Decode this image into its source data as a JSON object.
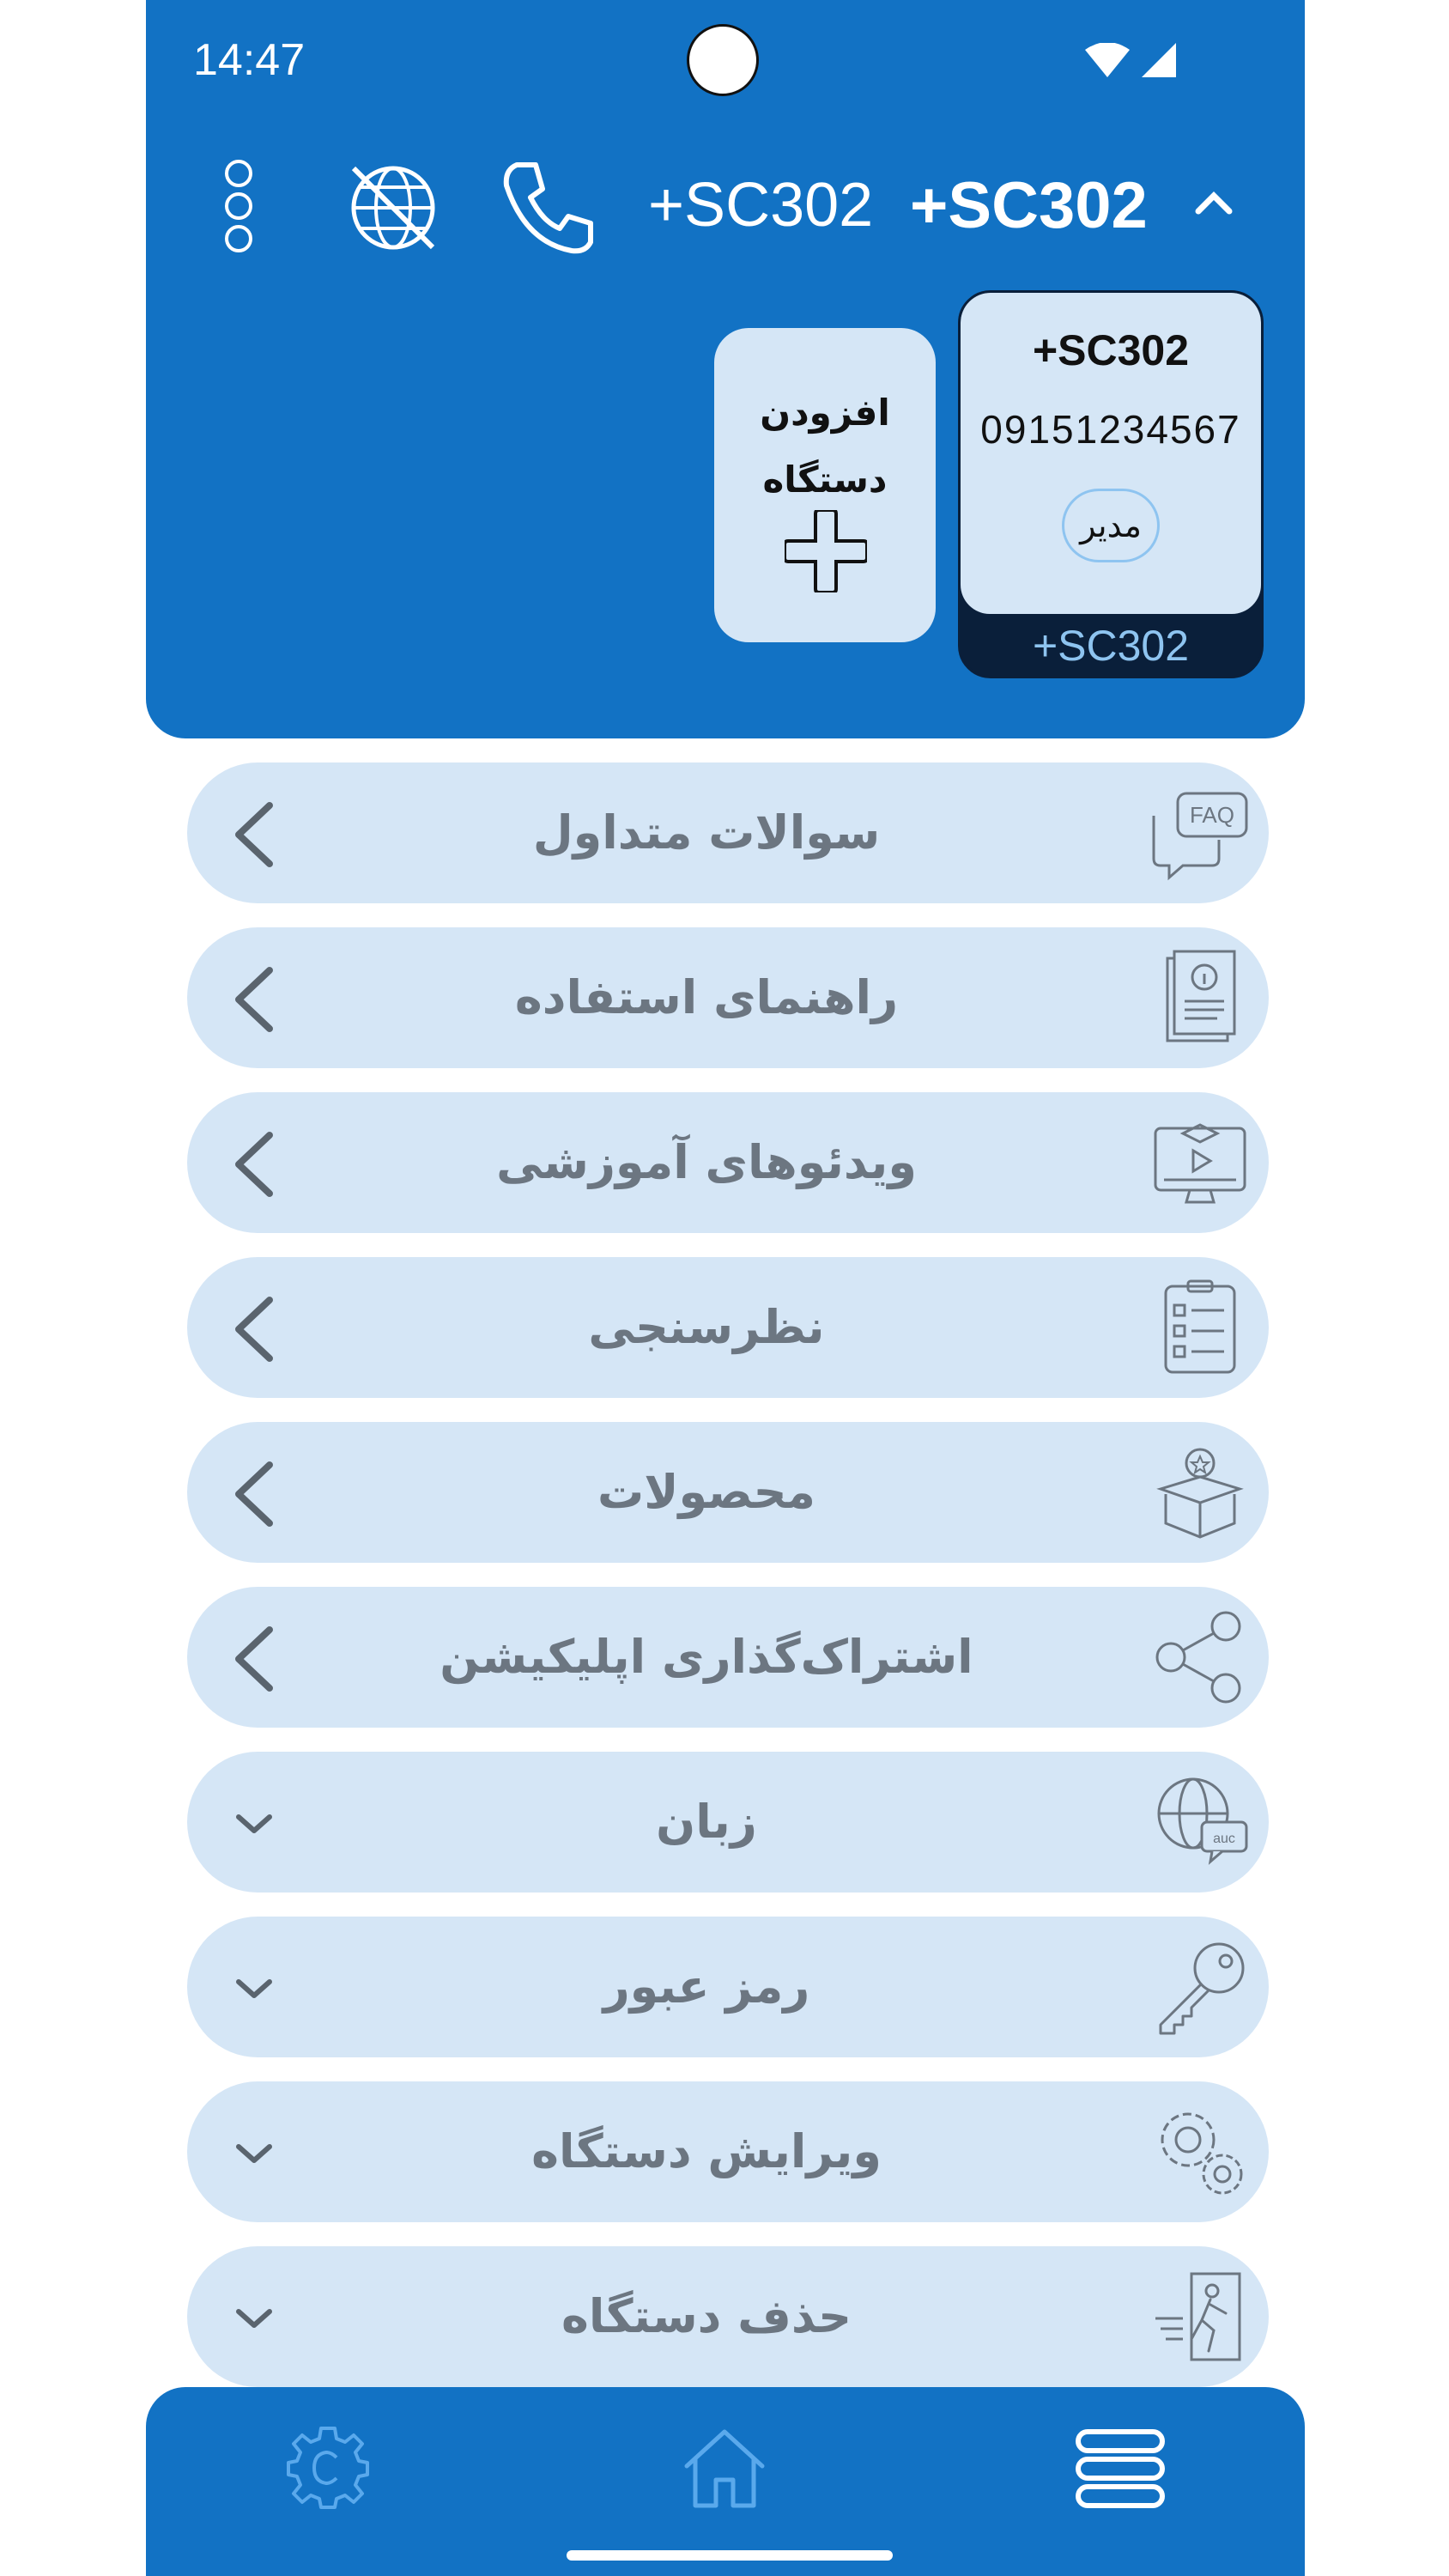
{
  "status_bar": {
    "time": "14:47"
  },
  "header": {
    "device_title_normal": "+SC302",
    "device_title_bold": "+SC302"
  },
  "add_device": {
    "label_line1": "افزودن",
    "label_line2": "دستگاه"
  },
  "device_card": {
    "name": "+SC302",
    "phone": "09151234567",
    "role": "مدیر",
    "footer": "+SC302"
  },
  "menu": {
    "items": [
      {
        "label": "سوالات متداول",
        "icon": "faq-icon",
        "indicator": "chevron-left"
      },
      {
        "label": "راهنمای استفاده",
        "icon": "guide-document-icon",
        "indicator": "chevron-left"
      },
      {
        "label": "ویدئوهای آموزشی",
        "icon": "video-tutorial-icon",
        "indicator": "chevron-left"
      },
      {
        "label": "نظرسنجی",
        "icon": "survey-checklist-icon",
        "indicator": "chevron-left"
      },
      {
        "label": "محصولات",
        "icon": "product-box-icon",
        "indicator": "chevron-left"
      },
      {
        "label": "اشتراک‌گذاری اپلیکیشن",
        "icon": "share-icon",
        "indicator": "chevron-left"
      },
      {
        "label": "زبان",
        "icon": "language-globe-icon",
        "indicator": "chevron-down"
      },
      {
        "label": "رمز عبور",
        "icon": "key-icon",
        "indicator": "chevron-down"
      },
      {
        "label": "ویرایش دستگاه",
        "icon": "gears-icon",
        "indicator": "chevron-down"
      },
      {
        "label": "حذف دستگاه",
        "icon": "exit-door-icon",
        "indicator": "chevron-down"
      }
    ]
  },
  "bottom_nav": {
    "items": [
      {
        "icon": "settings-gear-icon",
        "active": false
      },
      {
        "icon": "home-icon",
        "active": false
      },
      {
        "icon": "menu-stack-icon",
        "active": true
      }
    ]
  },
  "colors": {
    "primary": "#1272c4",
    "card_bg": "#d5e6f6",
    "dark": "#0a1f3a",
    "menu_text": "#6c7681",
    "accent_light": "#8ec4f0"
  }
}
